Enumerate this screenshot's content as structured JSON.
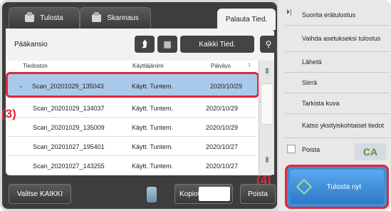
{
  "tabs": [
    {
      "label": "Tulosta",
      "icon": "print-icon"
    },
    {
      "label": "Skannaus",
      "icon": "scan-icon"
    },
    {
      "label": "Palauta Tied."
    }
  ],
  "folder": {
    "label": "Pääkansio",
    "all_files_label": "Kaikki Tied."
  },
  "columns": [
    "Tiedoston",
    "Käyttäjänimi",
    "Päiväys"
  ],
  "files": [
    {
      "name": "Scan_20201029_135043",
      "user": "Käytt. Tuntem.",
      "date": "2020/10/29"
    },
    {
      "name": "Scan_20201029_134037",
      "user": "Käytt. Tuntem.",
      "date": "2020/10/29"
    },
    {
      "name": "Scan_20201029_135009",
      "user": "Käytt. Tuntem.",
      "date": "2020/10/29"
    },
    {
      "name": "Scan_20201027_195401",
      "user": "Käytt. Tuntem.",
      "date": "2020/10/27"
    },
    {
      "name": "Scan_20201027_143255",
      "user": "Käytt. Tuntem.",
      "date": "2020/10/27"
    }
  ],
  "bottom": {
    "select_all": "Valitse KAIKKI",
    "copies": "Kopiota",
    "delete": "Poista"
  },
  "right_menu": [
    "Suorita erätulostus",
    "Vaihda asetukseksi tulostus",
    "Lähetä",
    "Siirrä",
    "Tarkista kuva",
    "Katso yksityiskohtaiset tiedot"
  ],
  "delete_checkbox": "Poista",
  "ca": "CA",
  "start": "Tulosta nyt",
  "callouts": {
    "c3": "(3)",
    "c4": "(4)"
  },
  "colors": {
    "highlight": "#e0283a",
    "selected_row": "#a9c9ea",
    "start_button": "#3e8fd6"
  }
}
